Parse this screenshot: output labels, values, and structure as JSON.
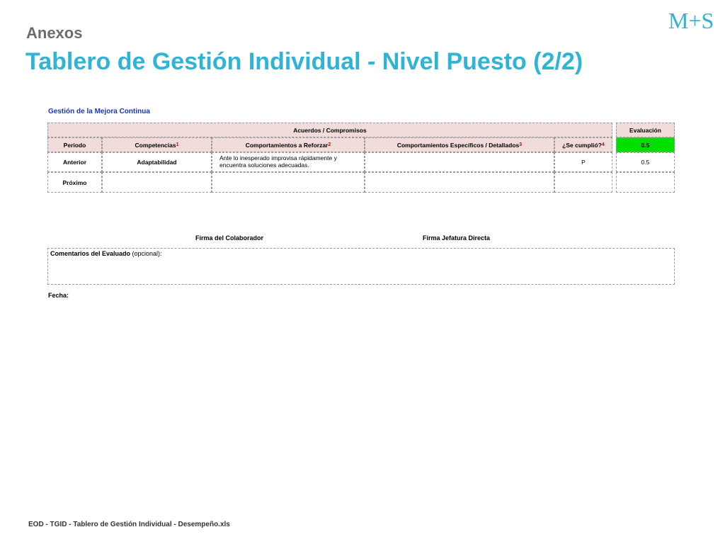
{
  "header": {
    "subtitle": "Anexos",
    "title": "Tablero de Gestión Individual - Nivel Puesto (2/2)",
    "logo_text": "M+S"
  },
  "section": {
    "title": "Gestión de la Mejora Continua"
  },
  "table": {
    "group_header": "Acuerdos / Compromisos",
    "evaluation_header": "Evaluación",
    "columns": {
      "period": "Periodo",
      "competencias": "Competencias",
      "competencias_note": "1",
      "reforzar": "Comportamientos a Reforzar",
      "reforzar_note": "2",
      "especificos": "Comportamientos Específicos / Detallados",
      "especificos_note": "3",
      "cumplio": "¿Se cumplió?",
      "cumplio_note": "4",
      "evaluation_value": "0.5"
    },
    "rows": [
      {
        "period": "Anterior",
        "competencia": "Adaptabilidad",
        "reforzar": "Ante lo inesperado improvisa rápidamente y encuentra soluciones adecuadas.",
        "especificos": "",
        "cumplio": "P",
        "evaluacion": "0.5"
      },
      {
        "period": "Próximo",
        "competencia": "",
        "reforzar": "",
        "especificos": "",
        "cumplio": "",
        "evaluacion": ""
      }
    ]
  },
  "signatures": {
    "colaborador": "Firma del Colaborador",
    "jefatura": "Firma Jefatura Directa"
  },
  "comments": {
    "label": "Comentarios del Evaluado",
    "optional": " (opcional):"
  },
  "fecha_label": "Fecha:",
  "footer": "EOD - TGID - Tablero de Gestión Individual - Desempeño.xls",
  "colors": {
    "title": "#2fb4d6",
    "section_title": "#1a33c4",
    "header_fill": "#f2dcdb",
    "highlight_green": "#00e000",
    "note_red": "#d00000"
  }
}
